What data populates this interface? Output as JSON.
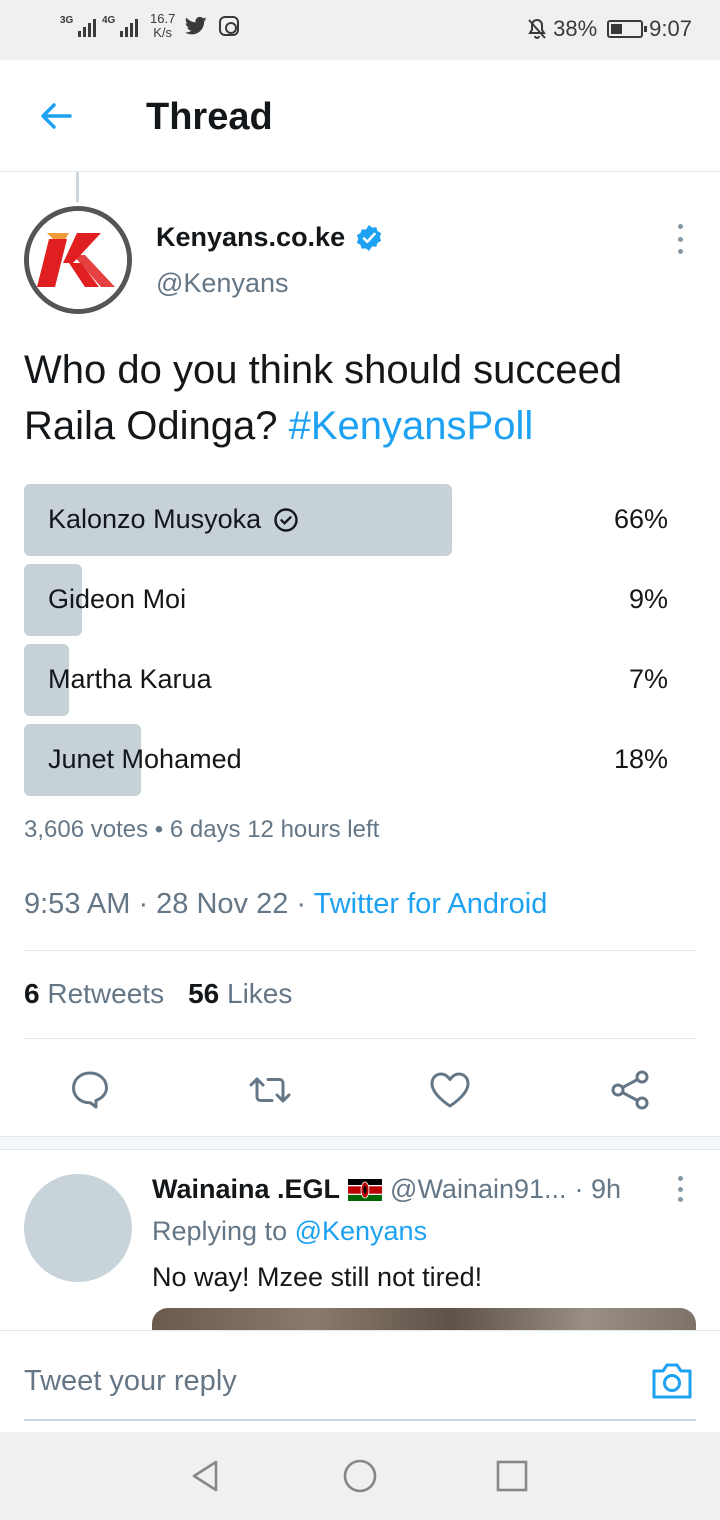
{
  "status_bar": {
    "network1": "3G",
    "network2": "4G",
    "speed_value": "16.7",
    "speed_unit": "K/s",
    "battery": "38%",
    "battery_level": 0.38,
    "time": "9:07",
    "icons": [
      "signal-icon",
      "twitter-icon",
      "instagram-icon",
      "mute-icon",
      "battery-icon"
    ]
  },
  "header": {
    "title": "Thread"
  },
  "tweet": {
    "author_name": "Kenyans.co.ke",
    "author_handle": "@Kenyans",
    "text": "Who do you think should succeed Raila Odinga? ",
    "hashtag": "#KenyansPoll",
    "poll": {
      "options": [
        {
          "label": "Kalonzo Musyoka",
          "percent": "66%",
          "fraction": 0.66,
          "winner": true
        },
        {
          "label": "Gideon Moi",
          "percent": "9%",
          "fraction": 0.09,
          "winner": false
        },
        {
          "label": "Martha Karua",
          "percent": "7%",
          "fraction": 0.07,
          "winner": false
        },
        {
          "label": "Junet Mohamed",
          "percent": "18%",
          "fraction": 0.18,
          "winner": false
        }
      ],
      "meta": "3,606 votes • 6 days 12 hours left"
    },
    "time": "9:53 AM · 28 Nov 22 · ",
    "source": "Twitter for Android",
    "retweets_count": "6",
    "retweets_label": "Retweets",
    "likes_count": "56",
    "likes_label": "Likes"
  },
  "reply": {
    "name": "Wainaina .EGL",
    "handle": "@Wainain91...",
    "time": "· 9h",
    "replying_prefix": "Replying to ",
    "replying_to": "@Kenyans",
    "text": "No way! Mzee still not tired!"
  },
  "compose": {
    "placeholder": "Tweet your reply"
  },
  "colors": {
    "accent": "#1da1f2",
    "poll_bar": "#c6d1d8",
    "muted_text": "#657786"
  }
}
